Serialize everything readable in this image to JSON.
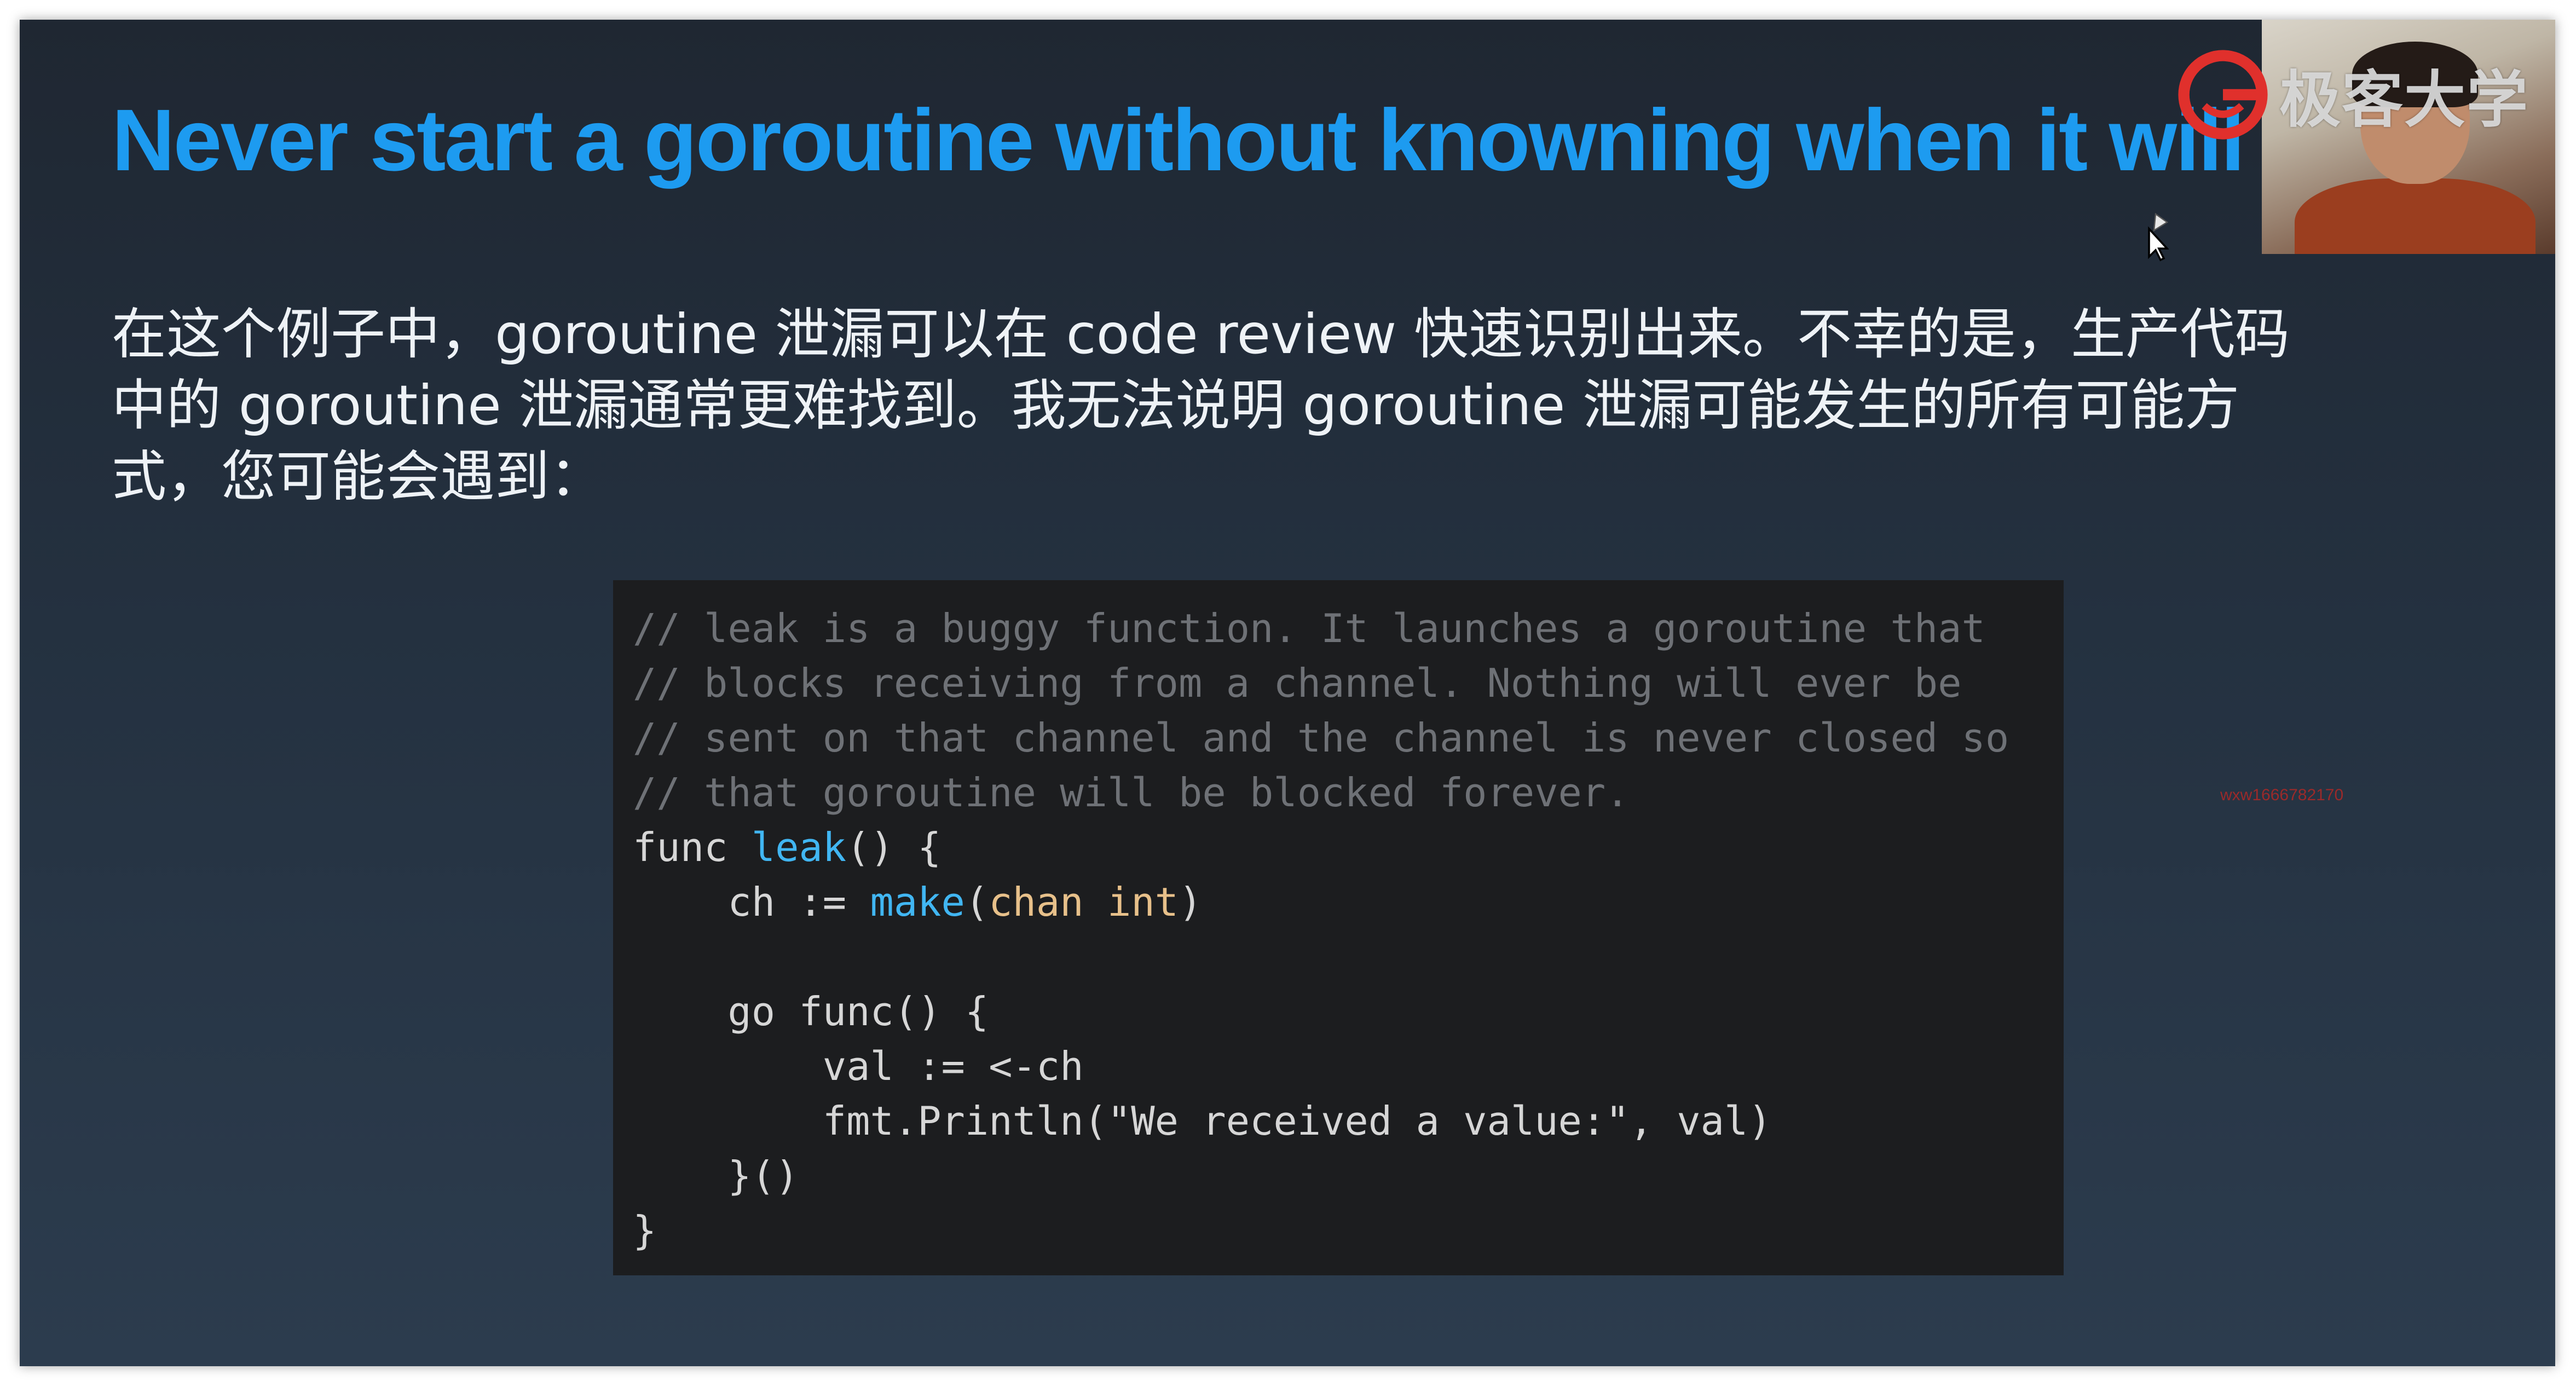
{
  "slide": {
    "title": "Never start a goroutine without knowning when it will s",
    "body_text": "在这个例子中，goroutine 泄漏可以在 code review 快速识别出来。不幸的是，生产代码中的 goroutine 泄漏通常更难找到。我无法说明 goroutine 泄漏可能发生的所有可能方式，您可能会遇到："
  },
  "code": {
    "lines": [
      [
        {
          "t": "// leak is a buggy function. It launches a goroutine that",
          "c": "comment"
        }
      ],
      [
        {
          "t": "// blocks receiving from a channel. Nothing will ever be",
          "c": "comment"
        }
      ],
      [
        {
          "t": "// sent on that channel and the channel is never closed so",
          "c": "comment"
        }
      ],
      [
        {
          "t": "// that goroutine will be blocked forever.",
          "c": "comment"
        }
      ],
      [
        {
          "t": "func ",
          "c": "plain"
        },
        {
          "t": "leak",
          "c": "fn"
        },
        {
          "t": "() {",
          "c": "plain"
        }
      ],
      [
        {
          "t": "    ch := ",
          "c": "plain"
        },
        {
          "t": "make",
          "c": "fn"
        },
        {
          "t": "(",
          "c": "plain"
        },
        {
          "t": "chan int",
          "c": "type"
        },
        {
          "t": ")",
          "c": "plain"
        }
      ],
      [
        {
          "t": "",
          "c": "plain"
        }
      ],
      [
        {
          "t": "    go func() {",
          "c": "plain"
        }
      ],
      [
        {
          "t": "        val := <-ch",
          "c": "plain"
        }
      ],
      [
        {
          "t": "        fmt.Println(\"We received a value:\", val)",
          "c": "plain"
        }
      ],
      [
        {
          "t": "    }()",
          "c": "plain"
        }
      ],
      [
        {
          "t": "}",
          "c": "plain"
        }
      ]
    ]
  },
  "overlay": {
    "logo_text": "极客大学",
    "watermark": "wxw1666782170"
  },
  "colors": {
    "title": "#1d9bf0",
    "comment": "#6e7176",
    "function": "#41b6f2",
    "type": "#e7c08a",
    "logo_red": "#e0302c"
  },
  "icons": {
    "logo": "geek-university-logo-icon",
    "cursor": "pointer-cursor-icon"
  }
}
